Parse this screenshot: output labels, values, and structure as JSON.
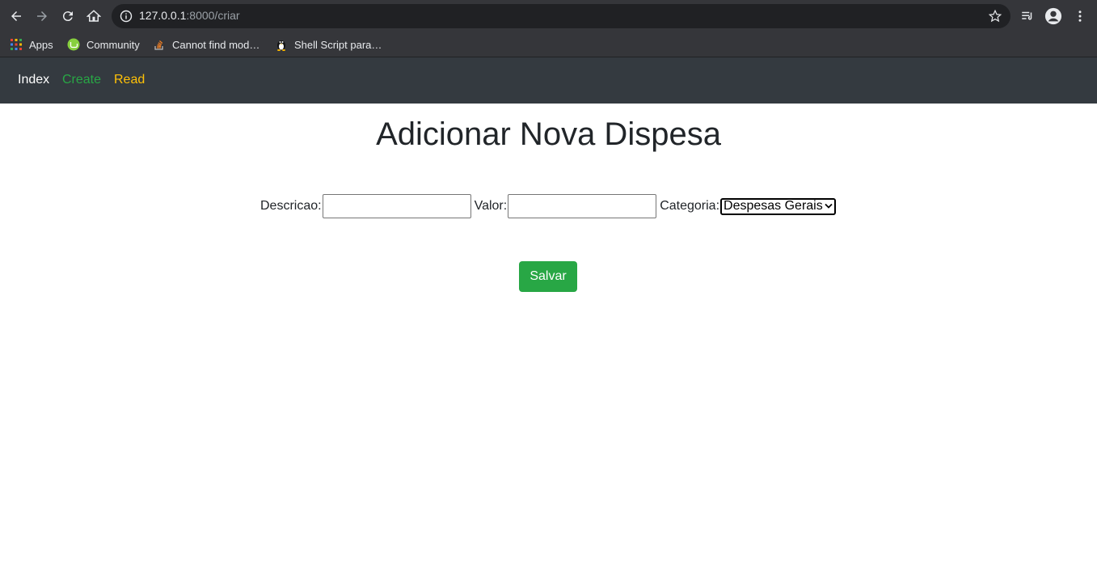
{
  "browser": {
    "url_host": "127.0.0.1",
    "url_path": ":8000/criar",
    "icons": [
      "back-icon",
      "forward-icon",
      "reload-icon",
      "home-icon",
      "info-icon",
      "star-icon",
      "reading-list-icon",
      "profile-icon",
      "menu-icon"
    ],
    "bookmarks": [
      {
        "label": "Apps",
        "icon": "apps-grid-icon"
      },
      {
        "label": "Community",
        "icon": "linux-mint-icon"
      },
      {
        "label": "Cannot find mod…",
        "icon": "stackoverflow-icon"
      },
      {
        "label": "Shell Script para…",
        "icon": "tux-icon"
      }
    ]
  },
  "navbar": {
    "links": [
      {
        "label": "Index",
        "color": "#ffffff"
      },
      {
        "label": "Create",
        "color": "#28a745"
      },
      {
        "label": "Read",
        "color": "#ffc107"
      }
    ],
    "background": "#343a40"
  },
  "page": {
    "title": "Adicionar Nova Dispesa",
    "form": {
      "descricao_label": "Descricao:",
      "descricao_value": "",
      "valor_label": "Valor:",
      "valor_value": "",
      "categoria_label": "Categoria:",
      "categoria_selected": "Despesas Gerais"
    },
    "save_label": "Salvar",
    "save_color": "#28a745"
  }
}
